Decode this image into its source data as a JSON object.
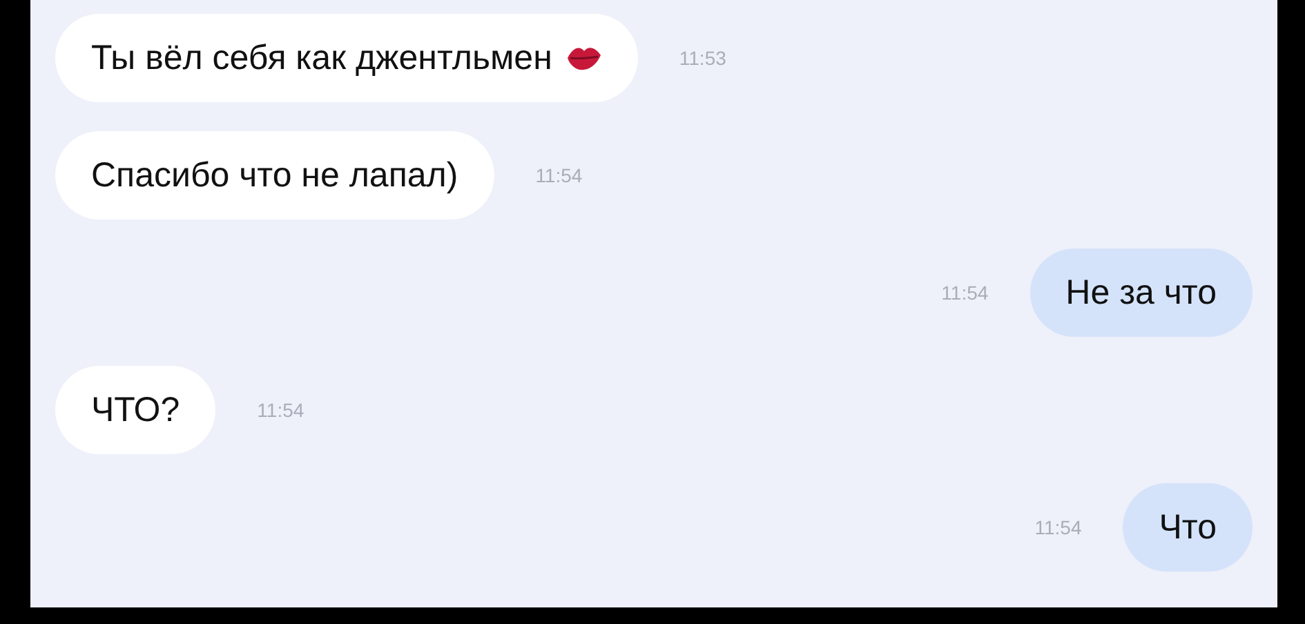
{
  "messages": [
    {
      "kind": "incoming",
      "text": "Ты вёл себя как джентльмен",
      "trailing_icon": true,
      "time": "11:53"
    },
    {
      "kind": "incoming",
      "text": "Спасибо что не лапал)",
      "time": "11:54"
    },
    {
      "kind": "outgoing",
      "text": "Не за что",
      "time": "11:54"
    },
    {
      "kind": "incoming",
      "text": "ЧТО?",
      "time": "11:54"
    },
    {
      "kind": "outgoing",
      "text": "Что",
      "time": "11:54"
    }
  ]
}
